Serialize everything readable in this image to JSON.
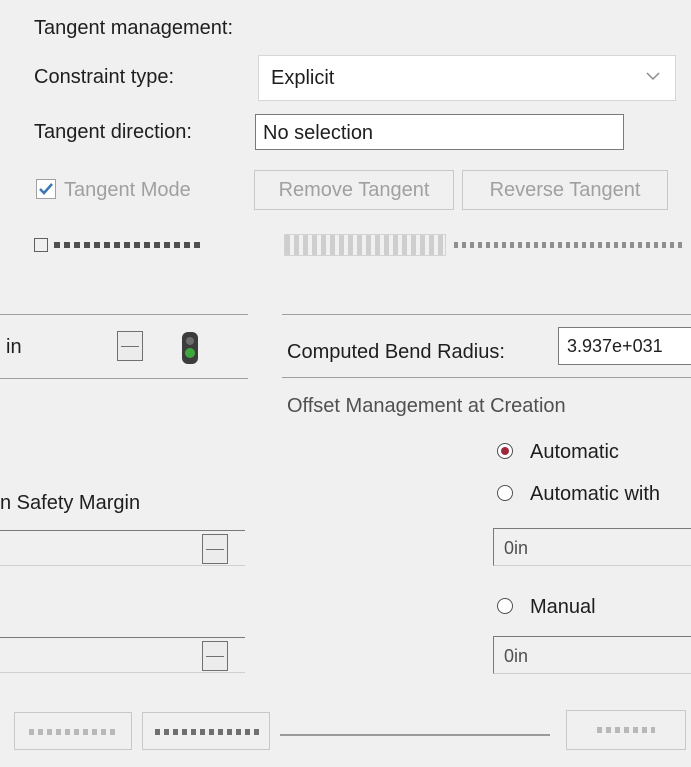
{
  "tangent": {
    "section_title": "Tangent management:",
    "constraint_type_label": "Constraint type:",
    "constraint_type_value": "Explicit",
    "tangent_direction_label": "Tangent direction:",
    "tangent_direction_value": "No selection",
    "tangent_mode_label": "Tangent Mode",
    "tangent_mode_checked": true,
    "remove_tangent_label": "Remove Tangent",
    "reverse_tangent_label": "Reverse Tangent"
  },
  "left_panel": {
    "length_value": "in",
    "safety_margin_label": "n Safety Margin",
    "field2_value": "",
    "field3_value": ""
  },
  "right_panel": {
    "computed_bend_radius_label": "Computed Bend Radius:",
    "computed_bend_radius_value": "3.937e+031",
    "offset_title": "Offset Management at Creation",
    "automatic_label": "Automatic",
    "automatic_with_label": "Automatic with",
    "offset_value_1": "0in",
    "manual_label": "Manual",
    "offset_value_2": "0in",
    "selected_offset_mode": "Automatic"
  },
  "colors": {
    "window_bg": "#f0f0f0",
    "radio_selected": "#a0283c",
    "checkbox_blue": "#3c78b4",
    "status_light_green": "#3ca83c"
  }
}
